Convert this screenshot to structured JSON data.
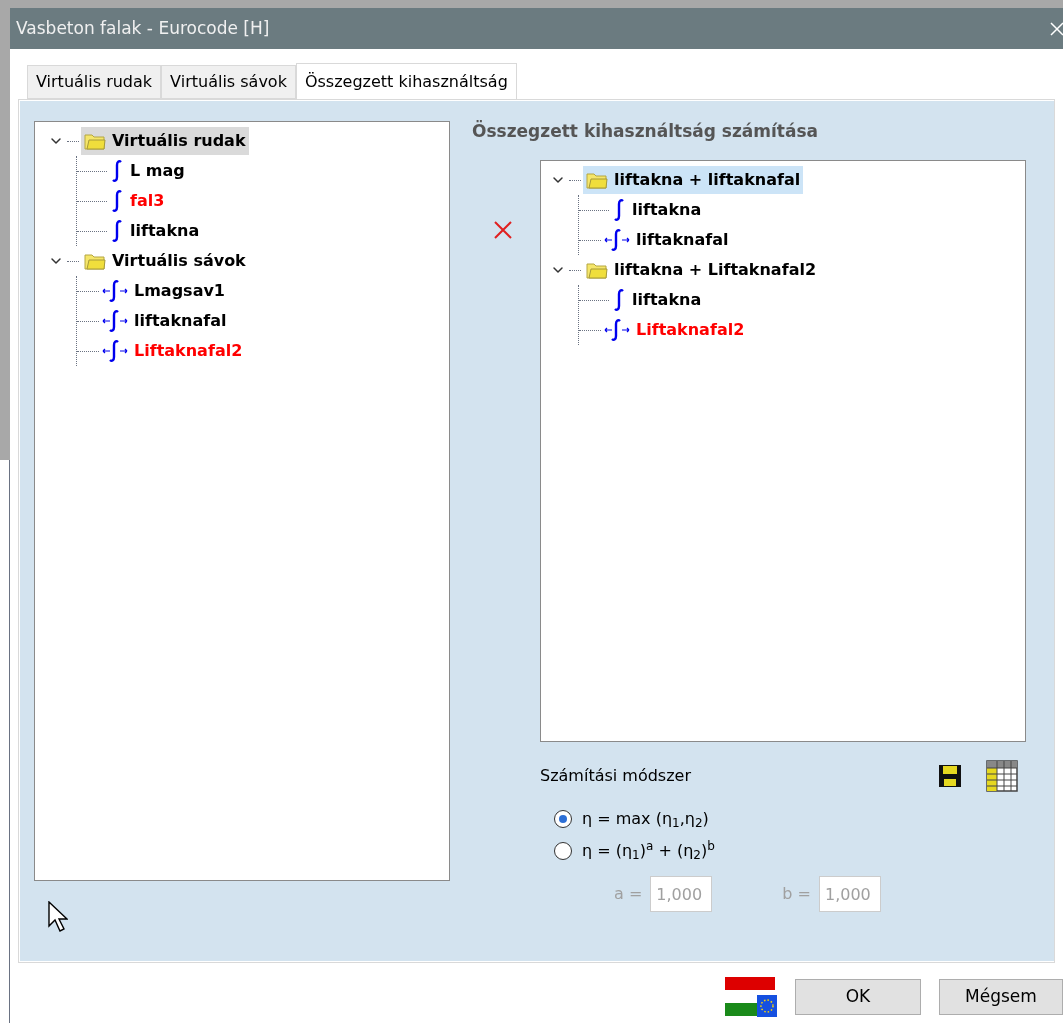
{
  "window": {
    "title": "Vasbeton falak - Eurocode [H]"
  },
  "tabs": [
    {
      "label": "Virtuális rudak",
      "selected": false
    },
    {
      "label": "Virtuális sávok",
      "selected": false
    },
    {
      "label": "Összegzett kihasználtság",
      "selected": true
    }
  ],
  "left_tree": {
    "items": [
      {
        "kind": "folder",
        "label": "Virtuális rudak",
        "selected": true,
        "expanded": true,
        "children": [
          {
            "kind": "bar",
            "label": "L mag",
            "selected": false,
            "color": "#000000"
          },
          {
            "kind": "bar",
            "label": "fal3",
            "selected": false,
            "color": "#ff0000"
          },
          {
            "kind": "bar",
            "label": "liftakna",
            "selected": false,
            "color": "#000000"
          }
        ]
      },
      {
        "kind": "folder",
        "label": "Virtuális sávok",
        "selected": false,
        "expanded": true,
        "children": [
          {
            "kind": "strip",
            "label": "Lmagsav1",
            "selected": false,
            "color": "#000000"
          },
          {
            "kind": "strip",
            "label": "liftaknafal",
            "selected": false,
            "color": "#000000"
          },
          {
            "kind": "strip",
            "label": "Liftaknafal2",
            "selected": false,
            "color": "#ff0000"
          }
        ]
      }
    ]
  },
  "right_panel": {
    "title": "Összegzett kihasználtság számítása",
    "tree": {
      "items": [
        {
          "kind": "folder",
          "label": "liftakna + liftaknafal",
          "selected": true,
          "expanded": true,
          "children": [
            {
              "kind": "bar",
              "label": "liftakna",
              "selected": false,
              "color": "#000000"
            },
            {
              "kind": "strip",
              "label": "liftaknafal",
              "selected": false,
              "color": "#000000"
            }
          ]
        },
        {
          "kind": "folder",
          "label": "liftakna + Liftaknafal2",
          "selected": false,
          "expanded": true,
          "children": [
            {
              "kind": "bar",
              "label": "liftakna",
              "selected": false,
              "color": "#000000"
            },
            {
              "kind": "strip",
              "label": "Liftaknafal2",
              "selected": false,
              "color": "#ff0000"
            }
          ]
        }
      ]
    }
  },
  "method": {
    "title": "Számítási módszer",
    "options": [
      {
        "label": "η = max (η$_{1}$,η$_{2}$)",
        "selected": true
      },
      {
        "label": "η = (η$_{1}$)$^{a}$ + (η$_{2}$)$^{b}$",
        "selected": false
      }
    ],
    "params": [
      {
        "label": "a =",
        "value": "1,000",
        "disabled": true
      },
      {
        "label": "b =",
        "value": "1,000",
        "disabled": true
      }
    ]
  },
  "buttons": [
    {
      "label": "OK"
    },
    {
      "label": "Mégsem"
    }
  ]
}
